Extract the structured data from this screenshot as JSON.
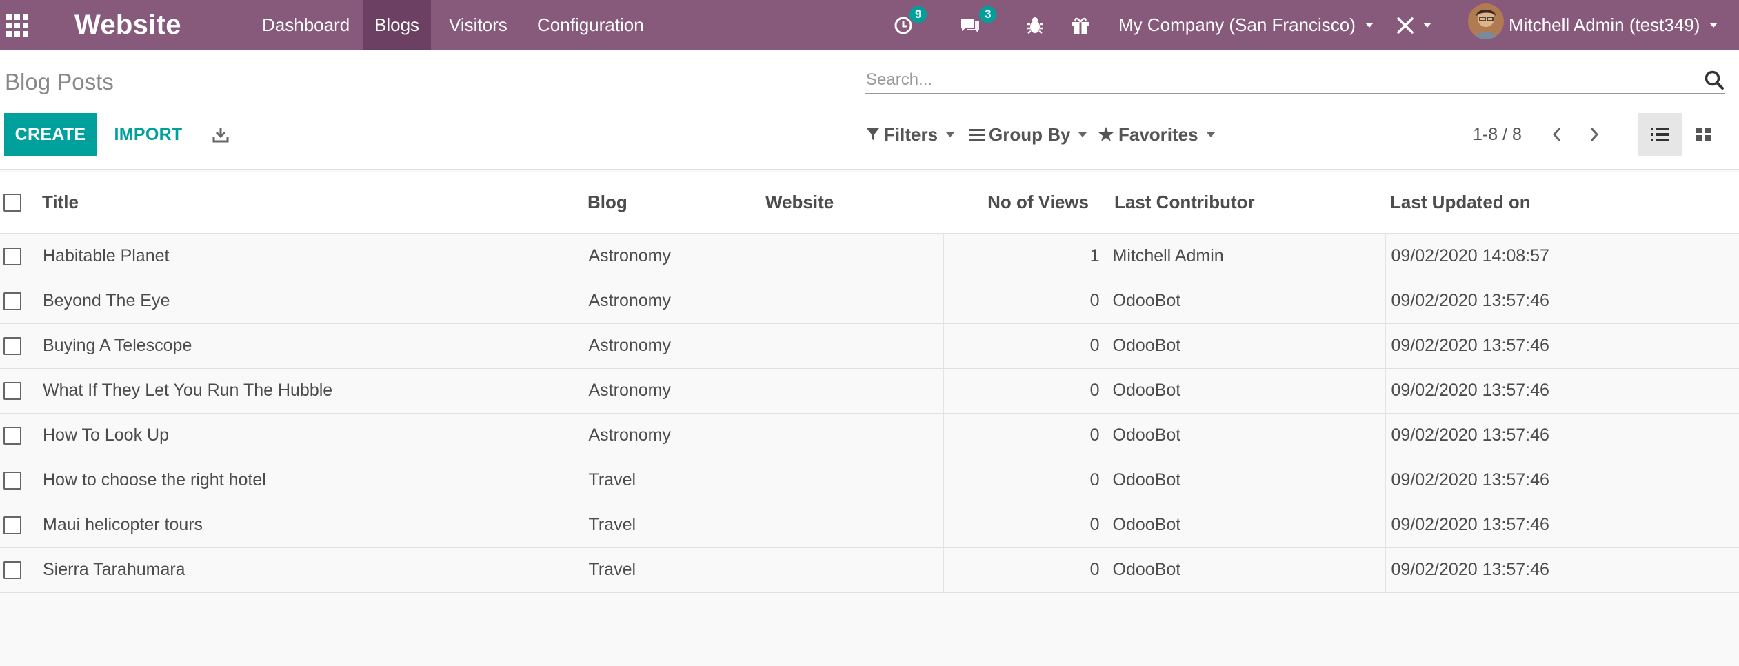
{
  "navbar": {
    "app_name": "Website",
    "menu": [
      "Dashboard",
      "Blogs",
      "Visitors",
      "Configuration"
    ],
    "activity_count": "9",
    "message_count": "3",
    "company": "My Company (San Francisco)",
    "user": "Mitchell Admin (test349)"
  },
  "breadcrumb": "Blog Posts",
  "search": {
    "placeholder": "Search..."
  },
  "buttons": {
    "create": "CREATE",
    "import": "IMPORT"
  },
  "search_panel": {
    "filters": "Filters",
    "group_by": "Group By",
    "favorites": "Favorites"
  },
  "pager": "1-8 / 8",
  "columns": {
    "title": "Title",
    "blog": "Blog",
    "website": "Website",
    "views": "No of Views",
    "contributor": "Last Contributor",
    "updated": "Last Updated on"
  },
  "rows": [
    {
      "title": "Habitable Planet",
      "blog": "Astronomy",
      "website": "",
      "views": "1",
      "contributor": "Mitchell Admin",
      "updated": "09/02/2020 14:08:57"
    },
    {
      "title": "Beyond The Eye",
      "blog": "Astronomy",
      "website": "",
      "views": "0",
      "contributor": "OdooBot",
      "updated": "09/02/2020 13:57:46"
    },
    {
      "title": "Buying A Telescope",
      "blog": "Astronomy",
      "website": "",
      "views": "0",
      "contributor": "OdooBot",
      "updated": "09/02/2020 13:57:46"
    },
    {
      "title": "What If They Let You Run The Hubble",
      "blog": "Astronomy",
      "website": "",
      "views": "0",
      "contributor": "OdooBot",
      "updated": "09/02/2020 13:57:46"
    },
    {
      "title": "How To Look Up",
      "blog": "Astronomy",
      "website": "",
      "views": "0",
      "contributor": "OdooBot",
      "updated": "09/02/2020 13:57:46"
    },
    {
      "title": "How to choose the right hotel",
      "blog": "Travel",
      "website": "",
      "views": "0",
      "contributor": "OdooBot",
      "updated": "09/02/2020 13:57:46"
    },
    {
      "title": "Maui helicopter tours",
      "blog": "Travel",
      "website": "",
      "views": "0",
      "contributor": "OdooBot",
      "updated": "09/02/2020 13:57:46"
    },
    {
      "title": "Sierra Tarahumara",
      "blog": "Travel",
      "website": "",
      "views": "0",
      "contributor": "OdooBot",
      "updated": "09/02/2020 13:57:46"
    }
  ],
  "colors": {
    "navbar": "#875a7b",
    "navbar_active": "#6c4062",
    "primary": "#00a09d",
    "badge": "#00a09d"
  },
  "icons": {
    "apps": "grid-icon",
    "activity": "clock-icon",
    "messages": "chat-icon",
    "debug": "bug-icon",
    "gift": "gift-icon",
    "tools": "tools-icon",
    "search": "search-icon",
    "download": "download-icon",
    "filters": "filter-icon",
    "group_by": "bars-icon",
    "favorites": "star-icon",
    "pager_prev": "chevron-left-icon",
    "pager_next": "chevron-right-icon",
    "list_view": "list-icon",
    "kanban_view": "kanban-icon"
  }
}
